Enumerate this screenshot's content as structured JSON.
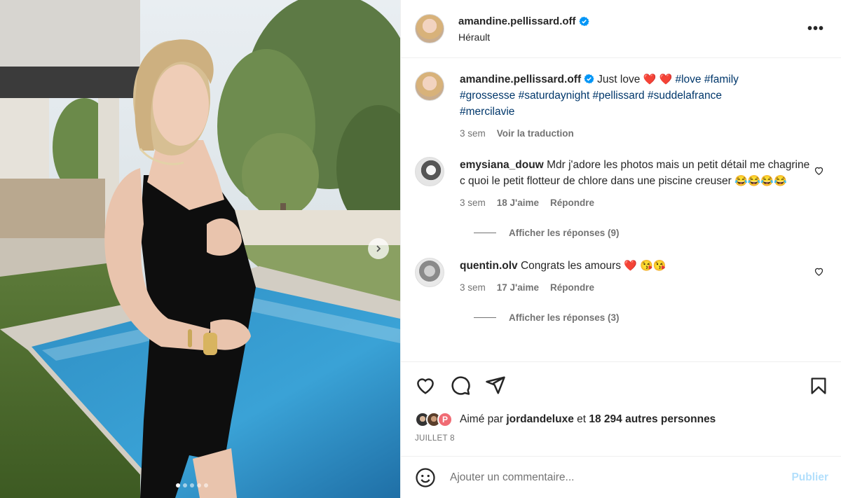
{
  "post": {
    "username": "amandine.pellissard.off",
    "location": "Hérault",
    "more_label": "•••",
    "carousel": {
      "slide_count": 5,
      "active_index": 0
    }
  },
  "caption": {
    "username": "amandine.pellissard.off",
    "text": "Just love",
    "emojis": "❤️ ❤️",
    "hashtags_line1": "#love #family",
    "hashtags_line2": "#grossesse #saturdaynight #pellissard #suddelafrance",
    "hashtags_line3": "#mercilavie",
    "time": "3 sem",
    "translate": "Voir la traduction"
  },
  "comments": [
    {
      "username": "emysiana_douw",
      "text": "Mdr j'adore les photos mais un petit détail me chagrine c quoi le petit flotteur de chlore dans une piscine creuser",
      "emojis": "😂😂😂😂",
      "time": "3 sem",
      "likes": "18 J'aime",
      "reply": "Répondre",
      "view_replies": "Afficher les réponses (9)"
    },
    {
      "username": "quentin.olv",
      "text": "Congrats les amours",
      "emojis": "❤️ 😘😘",
      "time": "3 sem",
      "likes": "17 J'aime",
      "reply": "Répondre",
      "view_replies": "Afficher les réponses (3)"
    }
  ],
  "likes": {
    "prefix": "Aimé par",
    "user": "jordandeluxe",
    "connector": "et",
    "others": "18 294 autres personnes",
    "badge": "P"
  },
  "date": "JUILLET 8",
  "add_comment": {
    "placeholder": "Ajouter un commentaire...",
    "publish": "Publier"
  },
  "colors": {
    "verified": "#0095f6",
    "link": "#00376b",
    "muted": "#737373",
    "publish_disabled": "#b2dffc"
  }
}
